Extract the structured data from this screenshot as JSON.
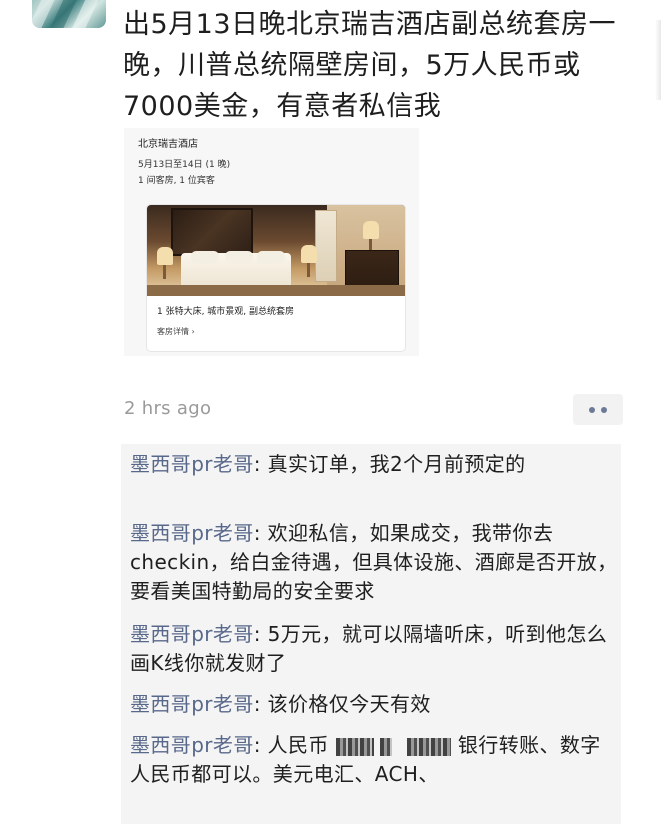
{
  "post": {
    "text": "出5月13日晚北京瑞吉酒店副总统套房一晚，川普总统隔壁房间，5万人民币或7000美金，有意者私信我"
  },
  "booking_card": {
    "hotel_name": "北京瑞吉酒店",
    "dates": "5月13日至14日 (1 晚)",
    "guests": "1 间客房, 1 位宾客",
    "room_description": "1 张特大床, 城市景观, 副总统套房",
    "room_details_link": "客房详情",
    "chevron": "›"
  },
  "meta": {
    "timestamp": "2 hrs ago"
  },
  "comments": [
    {
      "author": "墨西哥pr老哥",
      "text": "真实订单，我2个月前预定的"
    },
    {
      "author": "墨西哥pr老哥",
      "text": "欢迎私信，如果成交，我带你去checkin，给白金待遇，但具体设施、酒廊是否开放，要看美国特勤局的安全要求"
    },
    {
      "author": "墨西哥pr老哥",
      "text": "5万元，就可以隔墙听床，听到他怎么画K线你就发财了"
    },
    {
      "author": "墨西哥pr老哥",
      "text": "该价格仅今天有效"
    },
    {
      "author": "墨西哥pr老哥",
      "text_before": "人民币",
      "text_after": "银行转账、数字人民币都可以。美元电汇、ACH、"
    }
  ],
  "colors": {
    "author": "#58688a",
    "timestamp": "#9a9a9a",
    "comment_bg": "#f4f4f4",
    "more_dots": "#6b7a96"
  },
  "icons": {
    "more": "more-options-icon",
    "chevron": "chevron-right-icon"
  }
}
